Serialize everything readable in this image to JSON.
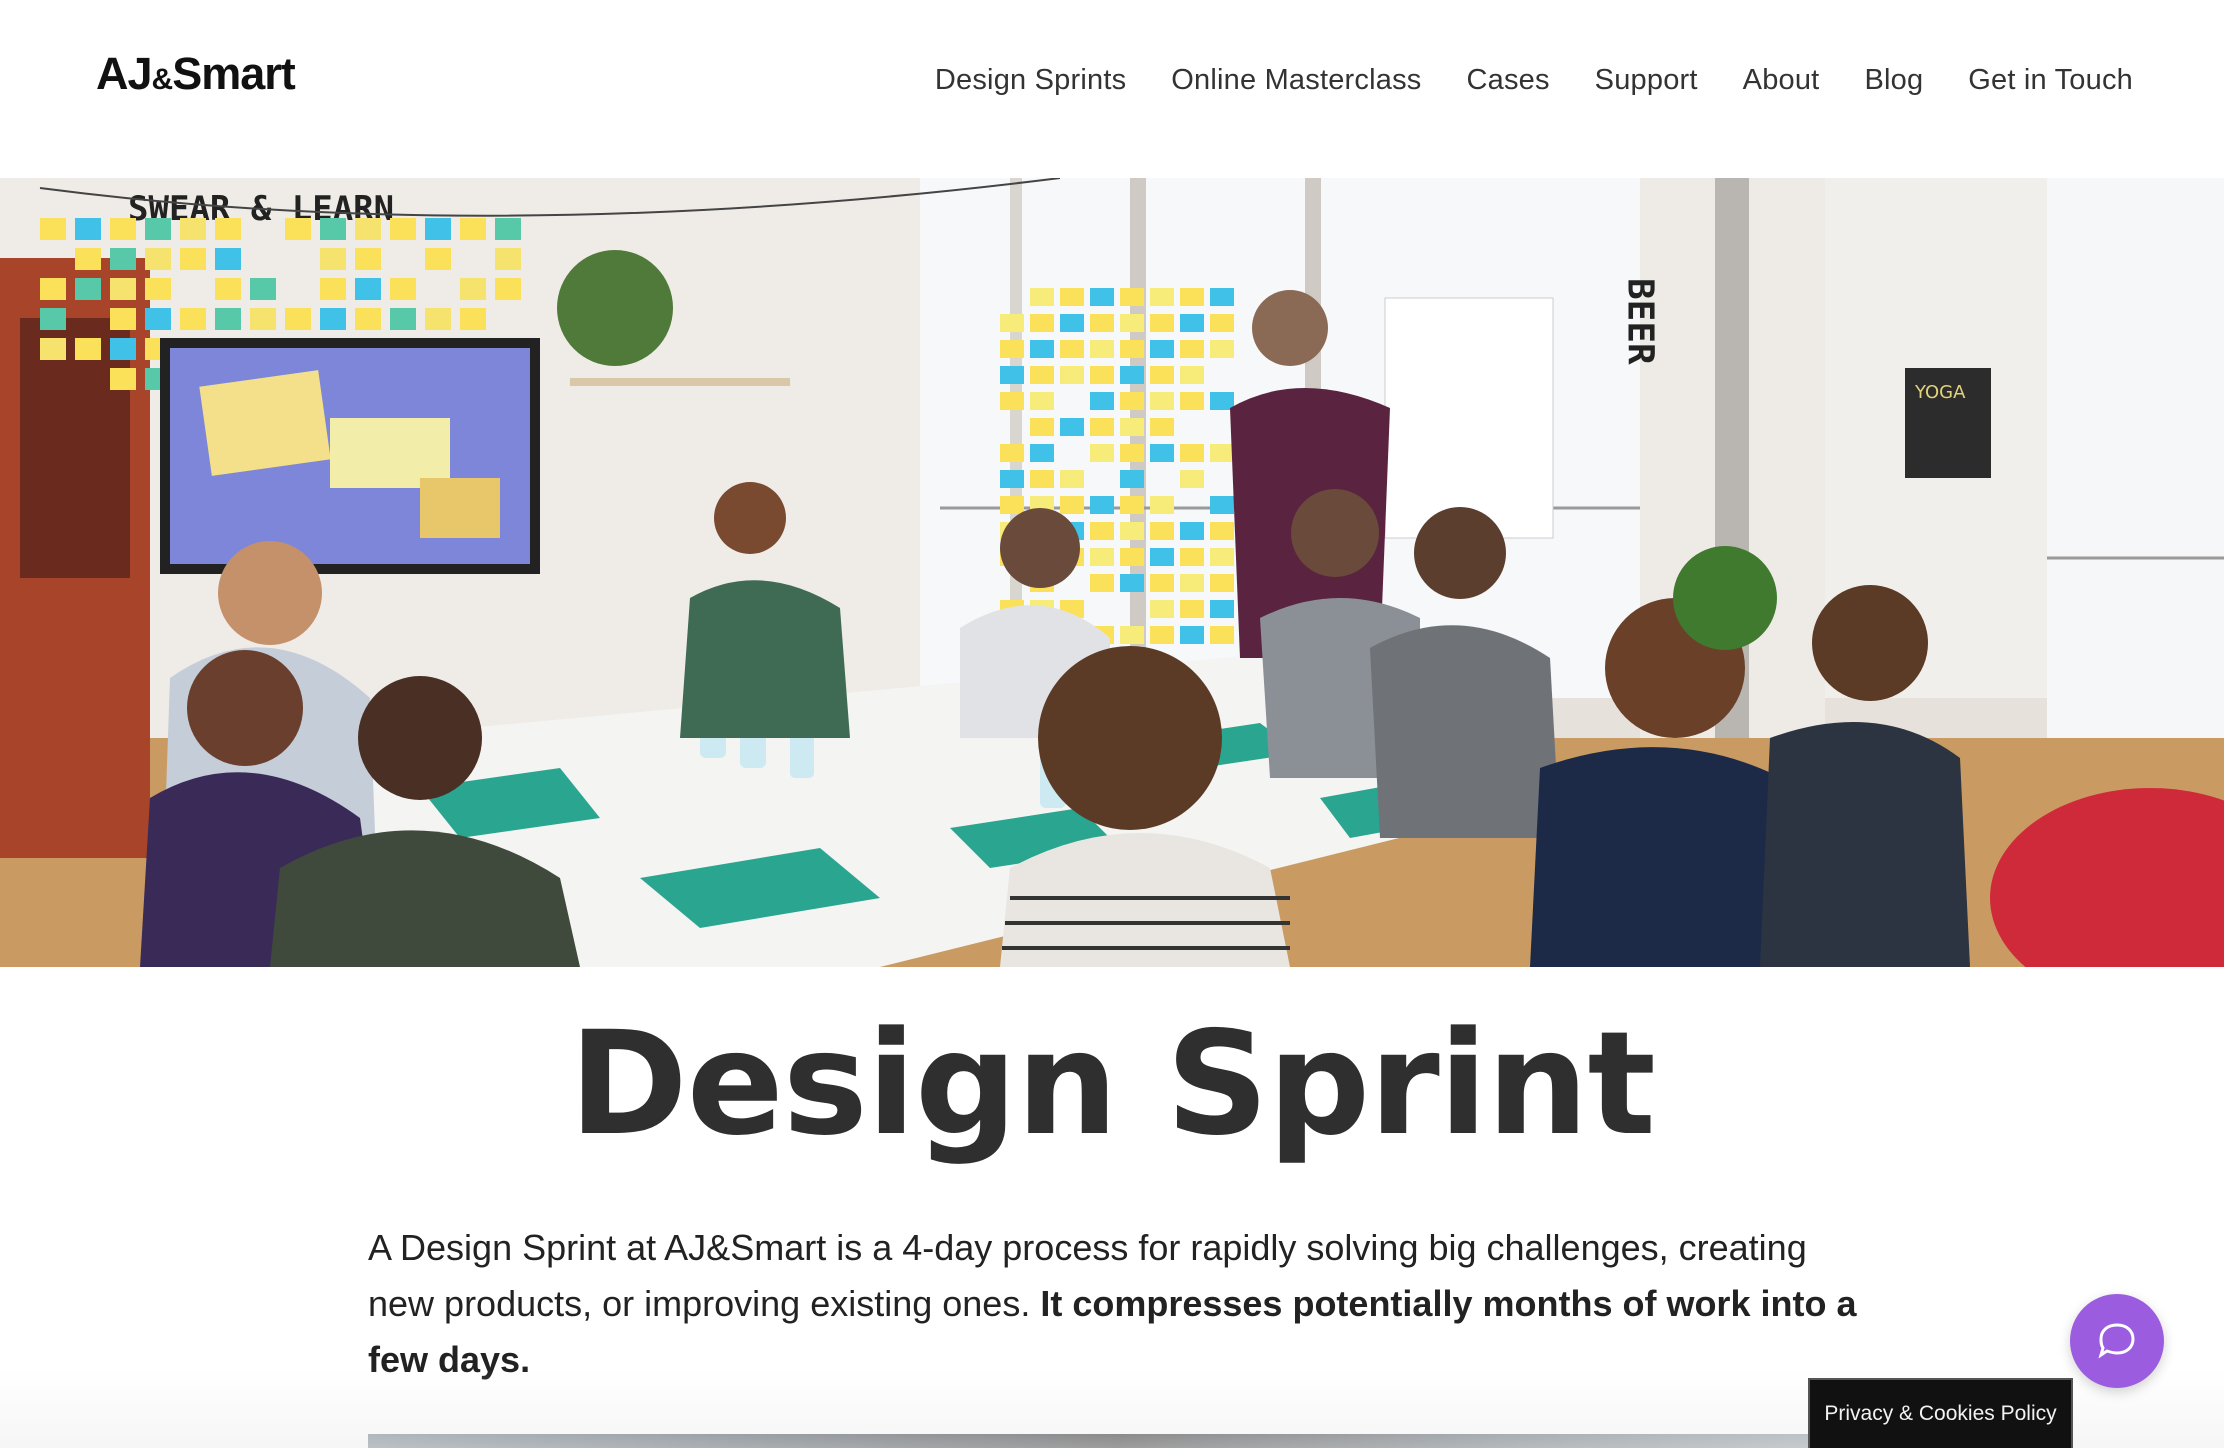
{
  "brand": {
    "logo_left": "AJ",
    "logo_amp": "&",
    "logo_right": "Smart"
  },
  "nav": {
    "items": [
      {
        "label": "Design Sprints"
      },
      {
        "label": "Online Masterclass"
      },
      {
        "label": "Cases"
      },
      {
        "label": "Support"
      },
      {
        "label": "About"
      },
      {
        "label": "Blog"
      },
      {
        "label": "Get in Touch"
      }
    ]
  },
  "hero": {
    "wall_sign": "SWEAR & LEARN",
    "pillar_sign": "BEER",
    "poster": "YOGA"
  },
  "page": {
    "title": "Design Sprint",
    "intro_plain": "A Design Sprint at AJ&Smart is a 4-day process for rapidly solving big challenges, creating new products, or improving existing ones. ",
    "intro_bold": "It compresses potentially months of work into a few days."
  },
  "widgets": {
    "chat_icon": "chat-bubble-icon",
    "privacy_label": "Privacy & Cookies Policy"
  },
  "colors": {
    "chat": "#9b5ce0",
    "privacy_bg": "#111111",
    "title": "#2f2f2f"
  }
}
